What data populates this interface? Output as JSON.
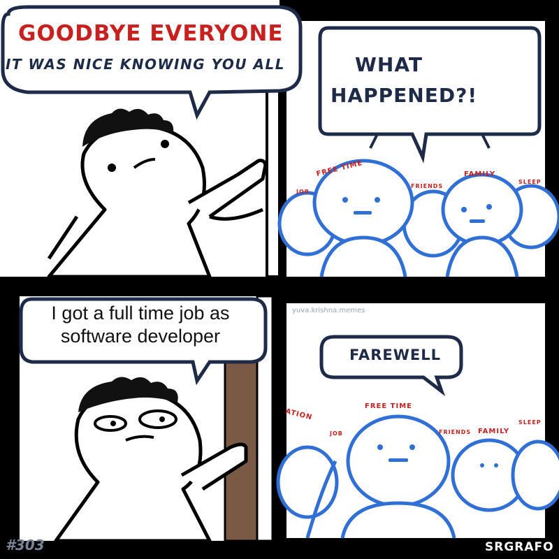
{
  "panel1": {
    "bubble_title": "GOODBYE EVERYONE",
    "bubble_sub": "IT WAS NICE KNOWING YOU ALL"
  },
  "panel2": {
    "bubble_line1": "WHAT",
    "bubble_line2": "HAPPENED?!",
    "tags": [
      "FREE TIME",
      "FRIENDS",
      "FAMILY",
      "JOB",
      "SLEEP"
    ]
  },
  "panel3": {
    "bubble_text": "I got a full time job as software developer"
  },
  "panel4": {
    "watermark": "yuva.krishna.memes",
    "bubble_text": "FAREWELL",
    "tags": [
      "FREE TIME",
      "JOB",
      "FRIENDS",
      "FAMILY",
      "SLEEP",
      "ATION"
    ]
  },
  "footer": {
    "issue": "#303",
    "brand": "SRGRAFO"
  },
  "colors": {
    "red": "#c8201e",
    "navy": "#1e2b48",
    "blue": "#2f6fd6",
    "door": "#7a5a44"
  }
}
